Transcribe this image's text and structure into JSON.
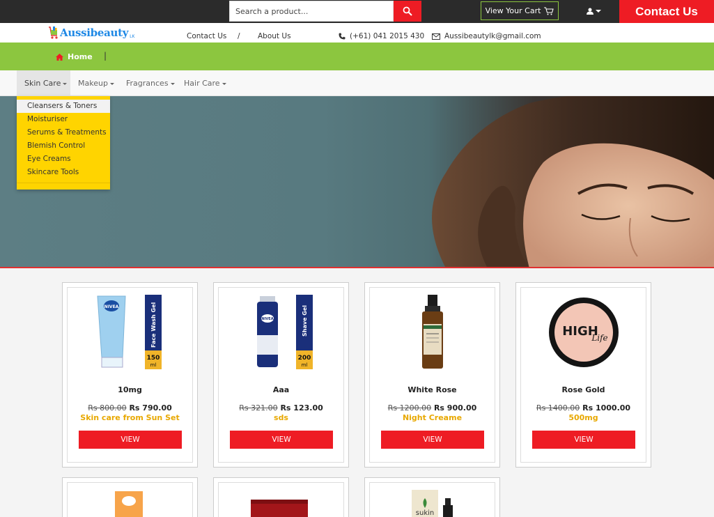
{
  "topbar": {
    "search_placeholder": "Search a product...",
    "cart_label": "View Your Cart",
    "contact_label": "Contact Us"
  },
  "header": {
    "logo_text": "Aussibeauty",
    "logo_suffix": "LK",
    "contact_link": "Contact Us",
    "separator": "/",
    "about_link": "About Us",
    "phone": "(+61) 041 2015 430",
    "email": "Aussibeautylk@gmail.com"
  },
  "breadcrumb": {
    "home": "Home",
    "separator": "|"
  },
  "nav": {
    "items": [
      {
        "label": "Skin Care"
      },
      {
        "label": "Makeup"
      },
      {
        "label": "Fragrances"
      },
      {
        "label": "Hair Care"
      }
    ]
  },
  "dropdown": {
    "items": [
      "Cleansers & Toners",
      "Moisturiser",
      "Serums & Treatments",
      "Blemish Control",
      "Eye Creams",
      "Skincare Tools"
    ]
  },
  "products": [
    {
      "name": "10mg",
      "old_price": "Rs 800.00",
      "price": "Rs 790.00",
      "subtitle": "Skin care from Sun Set",
      "button": "VIEW",
      "img_label": "Face Wash Gel",
      "img_qty": "150",
      "img_unit": "ml",
      "brand": "NIVEA"
    },
    {
      "name": "Aaa",
      "old_price": "Rs 321.00",
      "price": "Rs 123.00",
      "subtitle": "sds",
      "button": "VIEW",
      "img_label": "Shave Gel",
      "img_qty": "200",
      "img_unit": "ml",
      "brand": "NIVEA"
    },
    {
      "name": "White Rose",
      "old_price": "Rs 1200.00",
      "price": "Rs 900.00",
      "subtitle": "Night Creame",
      "button": "VIEW"
    },
    {
      "name": "Rose Gold",
      "old_price": "Rs 1400.00",
      "price": "Rs 1000.00",
      "subtitle": "500mg",
      "button": "VIEW",
      "compact_text": "HIGH",
      "compact_script": "Life"
    }
  ],
  "partial_products": [
    {
      "brand": "sukin"
    }
  ],
  "colors": {
    "accent_red": "#ee1c24",
    "brand_green": "#8cc63f",
    "dropdown_yellow": "#ffd400",
    "subtitle_gold": "#e8a800",
    "topbar_dark": "#2b2b2b"
  }
}
